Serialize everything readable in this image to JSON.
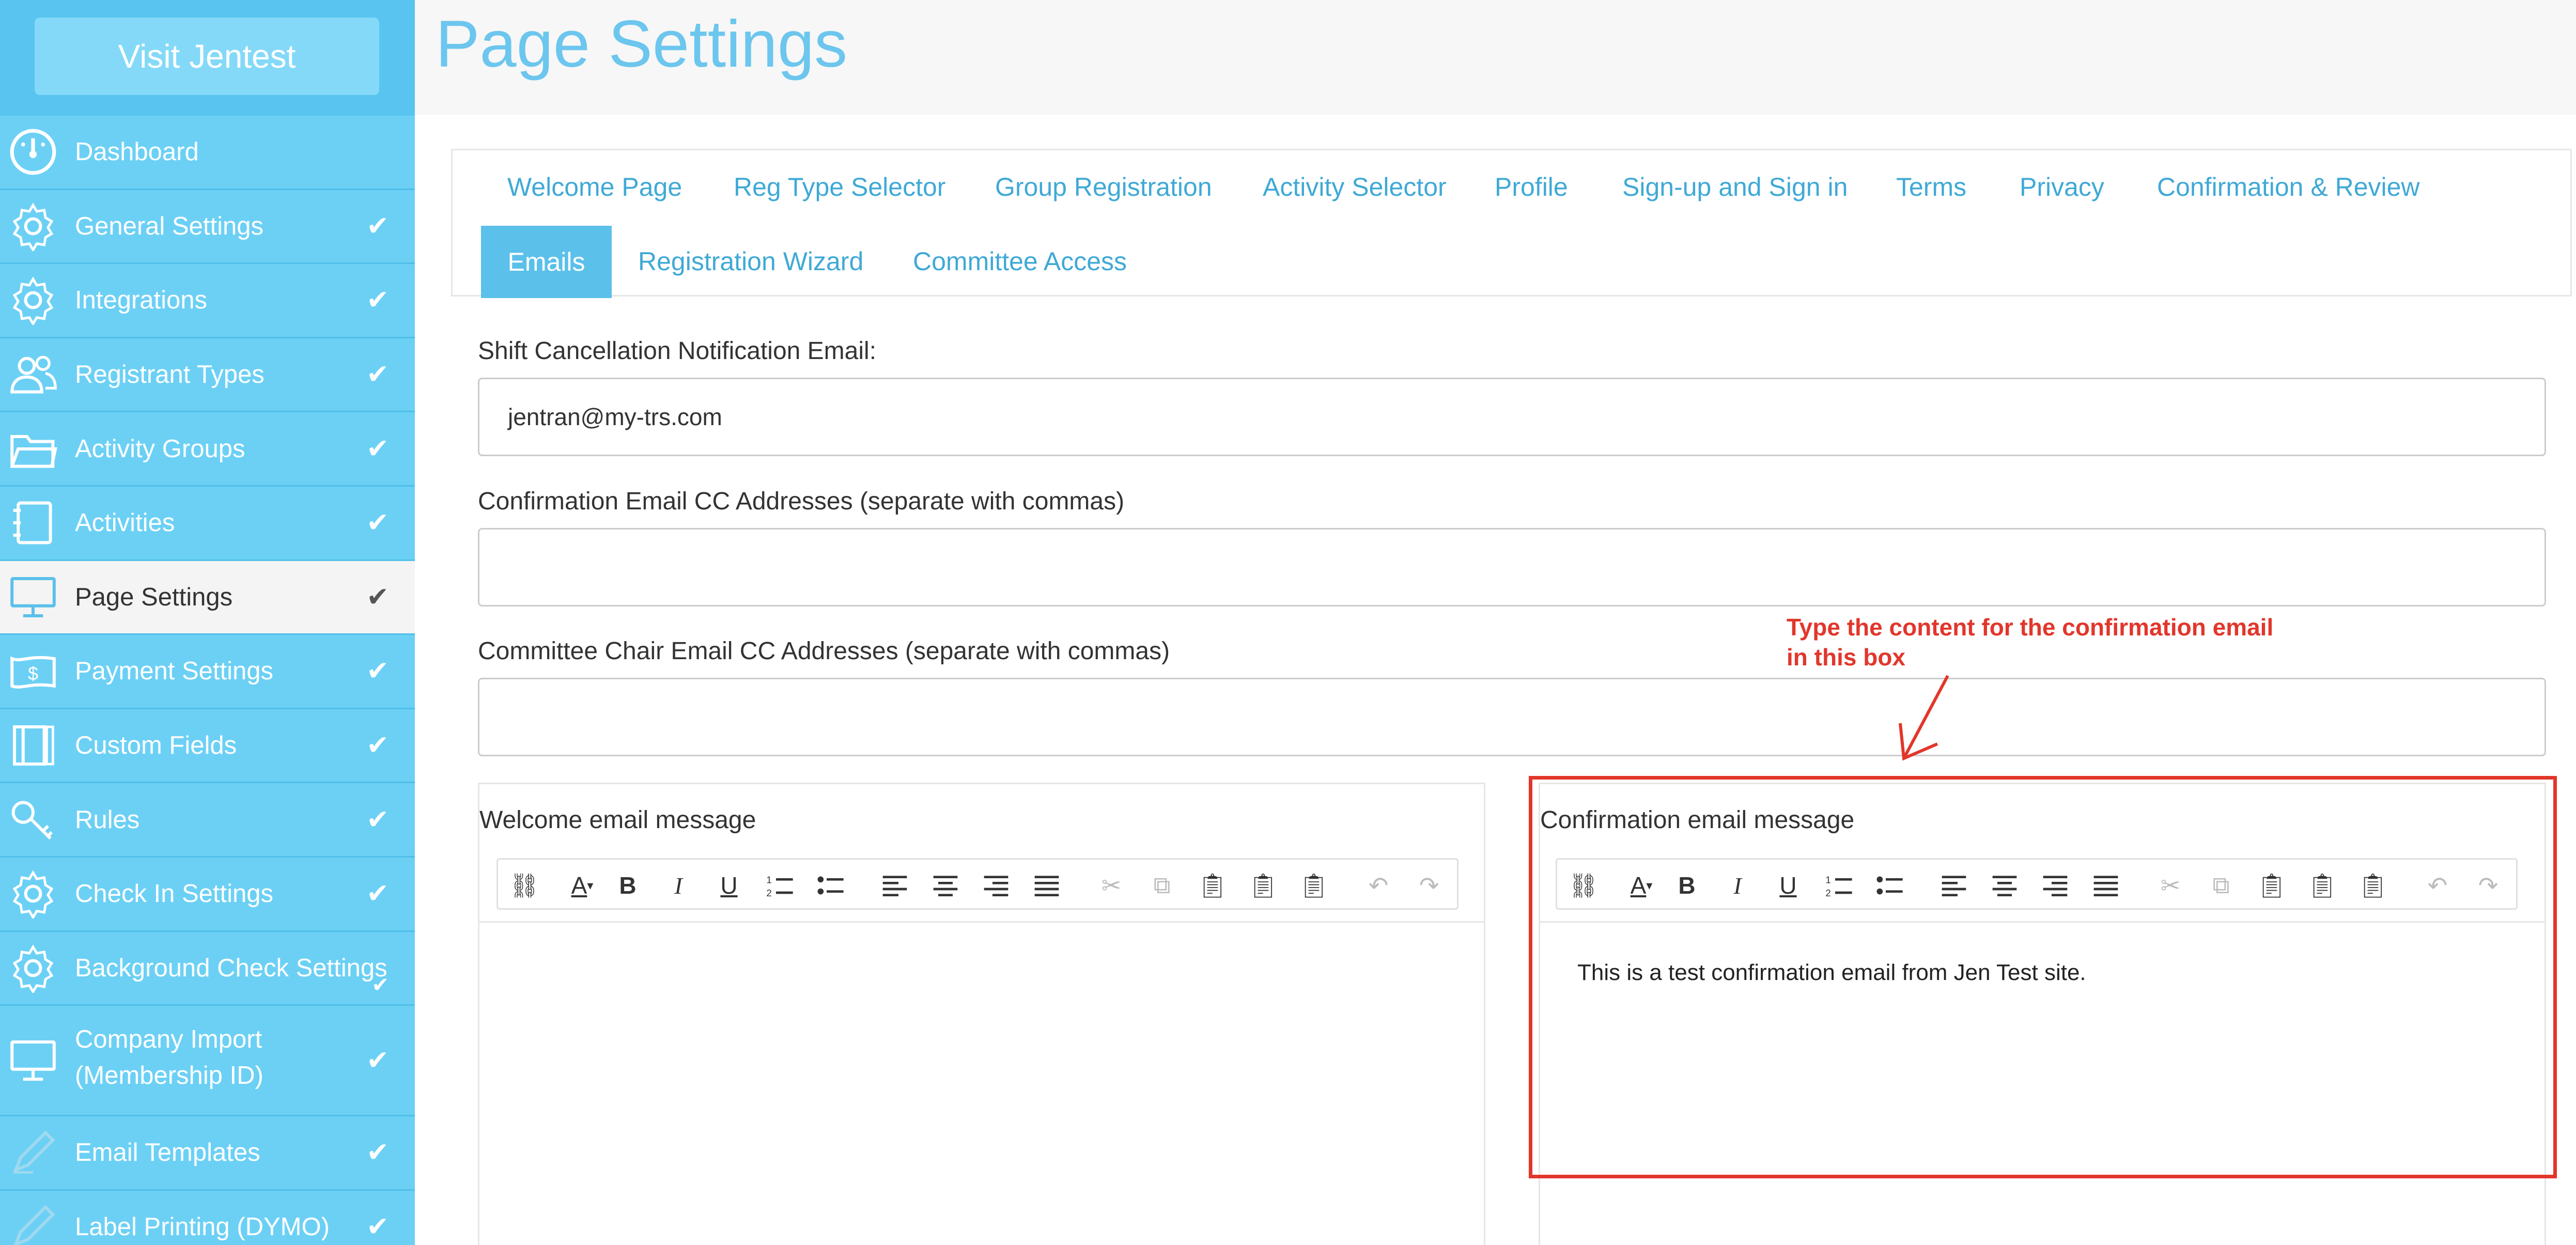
{
  "sidebar": {
    "visit_button": "Visit Jentest",
    "items": [
      {
        "label": "Dashboard",
        "check": "",
        "icon": "dashboard-icon"
      },
      {
        "label": "General Settings",
        "check": "✔",
        "icon": "gear-icon"
      },
      {
        "label": "Integrations",
        "check": "✔",
        "icon": "gear-icon"
      },
      {
        "label": "Registrant Types",
        "check": "✔",
        "icon": "users-icon"
      },
      {
        "label": "Activity Groups",
        "check": "✔",
        "icon": "folder-icon"
      },
      {
        "label": "Activities",
        "check": "✔",
        "icon": "notebook-icon"
      },
      {
        "label": "Page Settings",
        "check": "✔",
        "icon": "monitor-icon"
      },
      {
        "label": "Payment Settings",
        "check": "✔",
        "icon": "money-icon"
      },
      {
        "label": "Custom Fields",
        "check": "✔",
        "icon": "book-icon"
      },
      {
        "label": "Rules",
        "check": "✔",
        "icon": "key-icon"
      },
      {
        "label": "Check In Settings",
        "check": "✔",
        "icon": "gear-icon"
      },
      {
        "label": "Background Check Settings",
        "check": "✔",
        "icon": "gear-icon"
      },
      {
        "label": "Company Import",
        "label2": "(Membership ID)",
        "check": "✔",
        "icon": "monitor-icon"
      },
      {
        "label": "Email Templates",
        "check": "✔",
        "icon": "pencil-icon"
      },
      {
        "label": "Label Printing (DYMO)",
        "check": "✔",
        "icon": "pencil-icon"
      }
    ]
  },
  "header": {
    "title": "Page Settings"
  },
  "tabs": [
    "Welcome Page",
    "Reg Type Selector",
    "Group Registration",
    "Activity Selector",
    "Profile",
    "Sign-up and Sign in",
    "Terms",
    "Privacy",
    "Confirmation & Review",
    "Emails",
    "Registration Wizard",
    "Committee Access"
  ],
  "form": {
    "shift_label": "Shift Cancellation Notification Email:",
    "shift_value": "jentran@my-trs.com",
    "confirm_cc_label": "Confirmation Email CC Addresses (separate with commas)",
    "confirm_cc_value": "",
    "committee_cc_label": "Committee Chair Email CC Addresses (separate with commas)",
    "committee_cc_value": ""
  },
  "editors": {
    "welcome": {
      "title": "Welcome email message",
      "body": ""
    },
    "confirmation": {
      "title": "Confirmation email message",
      "body": "This is a test confirmation email from Jen Test site."
    }
  },
  "toolbar_buttons": [
    "link-icon",
    "font-color-icon",
    "bold-icon",
    "italic-icon",
    "underline-icon",
    "ordered-list-icon",
    "bullet-list-icon",
    "align-left-icon",
    "align-center-icon",
    "align-right-icon",
    "justify-icon",
    "cut-icon",
    "copy-icon",
    "paste-icon",
    "paste-text-icon",
    "paste-word-icon",
    "undo-icon",
    "redo-icon"
  ],
  "annotation": {
    "text_line1": "Type the content for the confirmation email",
    "text_line2": "in this box",
    "color": "#e2362b"
  },
  "colors": {
    "sidebar": "#6cd0f5",
    "accent": "#5bc0ea",
    "title": "#6cc6ee"
  }
}
